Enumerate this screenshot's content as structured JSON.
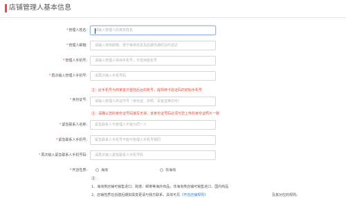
{
  "header": {
    "title": "店铺管理人基本信息"
  },
  "form": {
    "required_mark": "*",
    "fields": [
      {
        "label": "管理人姓名:",
        "placeholder": "请输入管理人的真实姓名"
      },
      {
        "label": "管理人邮箱:",
        "placeholder": "请输入常用邮箱，便于审核信息及后期沟通的及时送达"
      },
      {
        "label": "管理人手机号:",
        "placeholder": "请输入管理人常用手机号，不支持座机号"
      },
      {
        "label": "再次输入管理人手机号:",
        "placeholder": "请再次输入手机号码"
      },
      {
        "label": "身份证号:",
        "placeholder": "请输入管理人的证件号（身份证、护照、军官证等均可）"
      },
      {
        "label": "紧急联系人名称:",
        "placeholder": "紧急联系人与管理人不能为同一人"
      },
      {
        "label": "紧急联系人手机号:",
        "placeholder": "紧急联系人手机号不能与管理人手机号相同"
      },
      {
        "label": "再次输入紧急联系人手机号码:",
        "placeholder": "请再次输入紧急联系人手机号码"
      }
    ],
    "phone_notice": "注：此手机号为商家首次登陆后台的账号，提现绑卡验证码的初始手机号",
    "id_notice": "注：请确认您的身份证号码填写无误，该身份证号码必须与您上传的身份证照片一致",
    "opening_label": "开店性质:",
    "opening_options": [
      {
        "label": "海淘"
      },
      {
        "label": "非海淘"
      }
    ],
    "notes_title": "注：",
    "notes": [
      "1、海淘类店铺可销售进口、跨境、邮寄等海外商品，非海淘类店铺可销售进口、国内商品",
      "2、店铺性质在创建后期如需变更请与我方联系，具体可见"
    ],
    "notes_link": "《开店店铺规则》",
    "notes_tail": "及其对应的规则。"
  }
}
